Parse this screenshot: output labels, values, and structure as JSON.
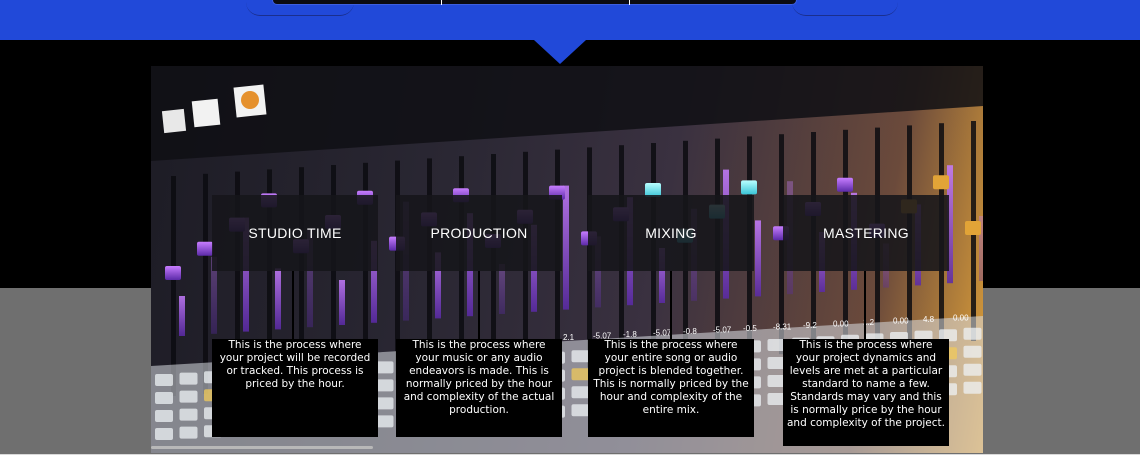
{
  "services": [
    {
      "title": "STUDIO TIME",
      "description": "This is the process where your project will be recorded or tracked. This process is priced by the hour."
    },
    {
      "title": "PRODUCTION",
      "description": "This is the process where your music or any audio endeavors is made. This is normally priced by the hour and complexity of the actual production."
    },
    {
      "title": "MIXING",
      "description": "This is the process where your entire song or audio project is blended together. This is normally priced by the hour and complexity of the entire mix."
    },
    {
      "title": "MASTERING",
      "description": "This is the process where your project dynamics and levels are met at a particular standard to name a few. Standards may vary and this is normally price by the hour and complexity of the project."
    }
  ],
  "colors": {
    "header_blue": "#2149d9",
    "band_black": "#000000",
    "band_gray": "#6f6f6f",
    "card_bg": "#16161a"
  },
  "photo_readouts": [
    "2.1",
    "-5.07",
    "-1.8",
    "-5.07",
    "-0.8",
    "-5.07",
    "-0.5",
    "-8.31",
    "-9.2",
    "0.00",
    "1.2",
    "0.00",
    "4.8",
    "0.00"
  ]
}
